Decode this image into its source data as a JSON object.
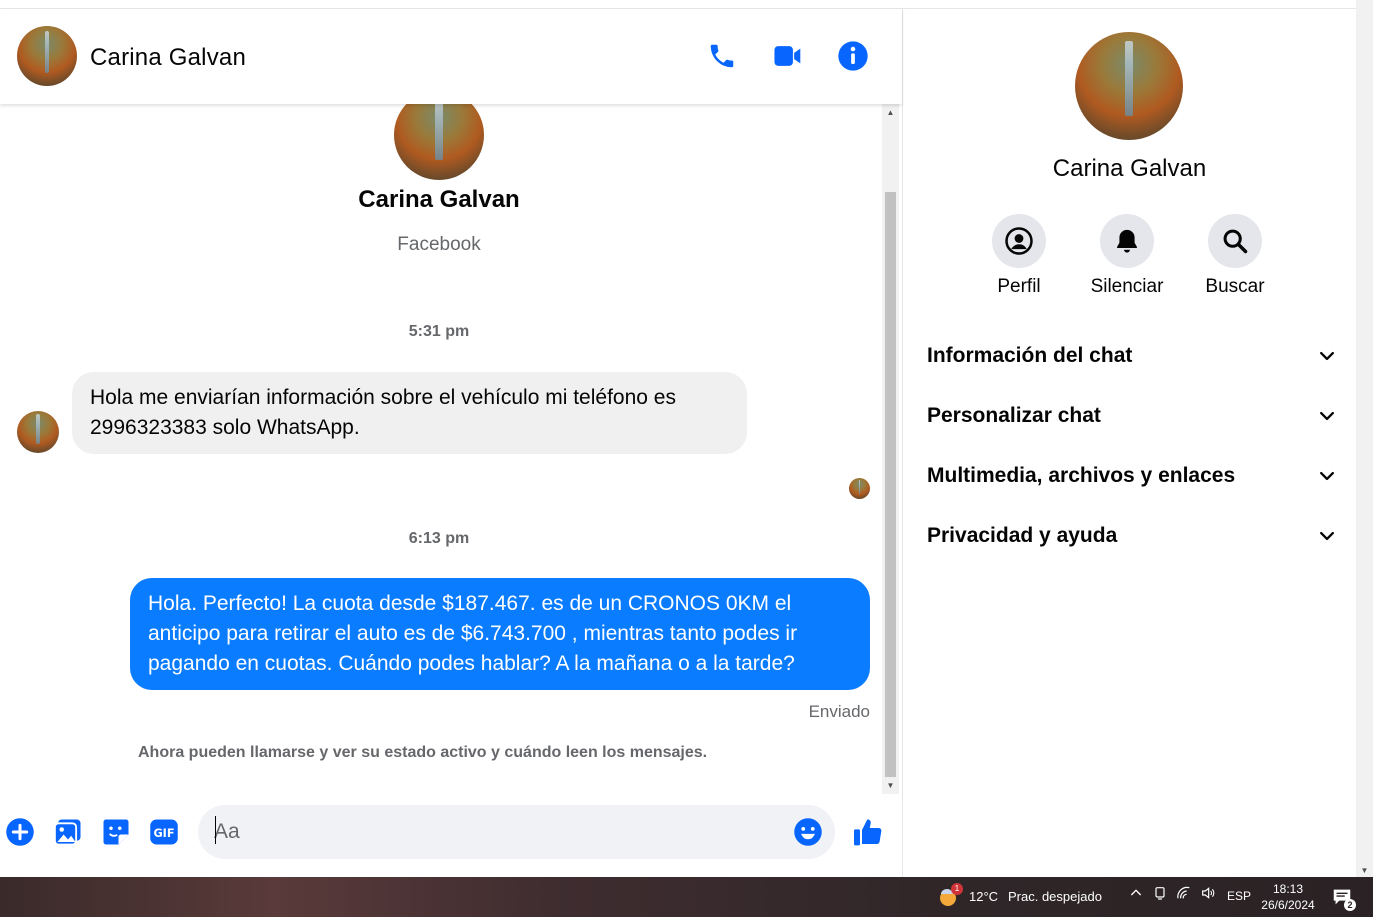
{
  "contact": {
    "name": "Carina Galvan",
    "source": "Facebook"
  },
  "header": {
    "call_icon": "phone-icon",
    "video_icon": "video-camera-icon",
    "info_icon": "info-icon"
  },
  "messages": {
    "time_1": "5:31 pm",
    "incoming_text": "Hola me enviarían información  sobre el vehículo mi teléfono es 2996323383  solo WhatsApp.",
    "time_2": "6:13 pm",
    "outgoing_text": "Hola. Perfecto! La cuota desde $187.467. es de un CRONOS 0KM el anticipo para retirar el auto es de $6.743.700 , mientras tanto podes ir pagando en cuotas. Cuándo podes hablar? A la mañana o a la tarde?",
    "status": "Enviado",
    "notice": "Ahora pueden llamarse y ver su estado activo y cuándo leen los mensajes."
  },
  "composer": {
    "placeholder": "Aa",
    "value": ""
  },
  "info_panel": {
    "name": "Carina Galvan",
    "actions": [
      {
        "label": "Perfil",
        "icon": "profile-icon"
      },
      {
        "label": "Silenciar",
        "icon": "bell-icon"
      },
      {
        "label": "Buscar",
        "icon": "search-icon"
      }
    ],
    "sections": [
      {
        "title": "Información del chat"
      },
      {
        "title": "Personalizar chat"
      },
      {
        "title": "Multimedia, archivos y enlaces"
      },
      {
        "title": "Privacidad y ayuda"
      }
    ]
  },
  "taskbar": {
    "weather_badge": "1",
    "temperature": "12°C",
    "condition": "Prac. despejado",
    "language": "ESP",
    "time": "18:13",
    "date": "26/6/2024",
    "notifications_badge": "2"
  },
  "colors": {
    "accent": "#0a7cff",
    "icon_blue": "#0866ff",
    "bubble_in": "#f0f0f0",
    "muted_text": "#65676b"
  }
}
